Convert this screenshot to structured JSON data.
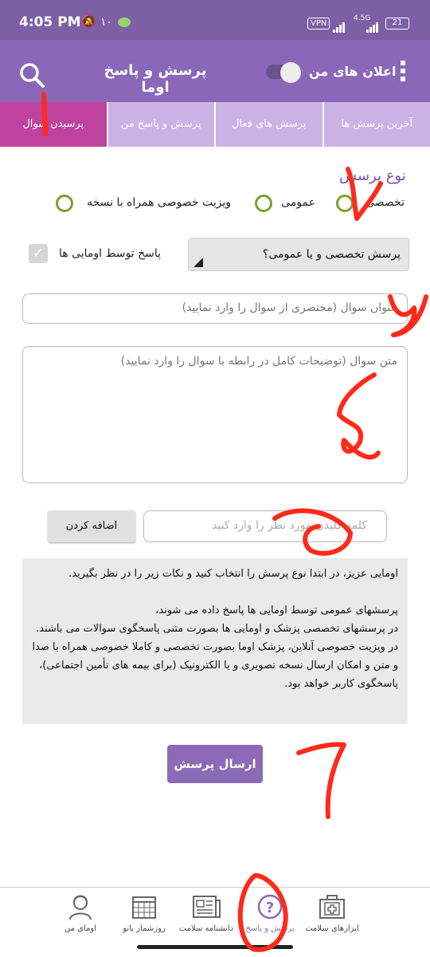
{
  "status_bar": {
    "time": "4:05 PM",
    "digit": "۱۰",
    "vpn": "VPN",
    "network": "4.5G",
    "battery": "21"
  },
  "header": {
    "title": "پرسش و پاسخ اوما",
    "notifications_label": "اعلان های من",
    "notifications_on": true
  },
  "tabs": [
    {
      "label": "آخرین پرسش ها",
      "active": false
    },
    {
      "label": "پرسش های فعال",
      "active": false
    },
    {
      "label": "پرسش و پاسخ من",
      "active": false
    },
    {
      "label": "پرسیدن سوال",
      "active": true
    }
  ],
  "form": {
    "type_label": "نوع پرسش",
    "radios": [
      {
        "label": "تخصصی"
      },
      {
        "label": "عمومی"
      },
      {
        "label": "ویزیت خصوصی همراه با نسخه"
      }
    ],
    "dropdown_text": "پرسش تخصصی و یا عمومی؟",
    "answer_by_umas_label": "پاسخ توسط اومایی ها",
    "answer_by_umas_checked": true,
    "title_placeholder": "عنوان سوال (مختصری از سوال را وارد نمایید)",
    "body_placeholder": "متن سوال (توضیحات کامل در رابطه با سوال را وارد نمایید)",
    "keyword_placeholder": "کلمه کلیدی مورد نظر را وارد کنید",
    "add_button": "اضافه کردن",
    "info_text": "اومایی عزیز، در ابتدا نوع پرسش را انتخاب کنید و نکات زیر را در نظر بگیرید.\n\nپرسشهای عمومی توسط اومایی ها پاسخ داده می شوند،\nدر پرسشهای تخصصی پزشک و اومایی ها بصورت متنی پاسخگوی سوالات می باشند.\nدر ویزیت خصوصی آنلاین، پزشک اوما بصورت تخصصی و کاملا خصوصی همراه با صدا و متن و امکان ارسال نسخه تصویری و یا الکترونیک (برای بیمه های تأمین اجتماعی)، پاسخگوی کاربر خواهد بود.",
    "submit_button": "ارسال پرسش"
  },
  "bottom_nav": [
    {
      "label": "اومای من",
      "icon": "user-icon"
    },
    {
      "label": "روزشمار بانو",
      "icon": "calendar-icon"
    },
    {
      "label": "دانشنامه سلامت",
      "icon": "newspaper-icon"
    },
    {
      "label": "پرسش و پاسخ",
      "icon": "question-icon",
      "active": true
    },
    {
      "label": "ابزارهای سلامت",
      "icon": "medical-kit-icon"
    }
  ],
  "annotations": [
    "۱",
    "۲",
    "۳",
    "۴",
    "۵",
    "۶"
  ],
  "colors": {
    "appbar": "#8a67b8",
    "statusbar": "#7d5fa6",
    "tab": "#ccb3e6",
    "tab_active": "#c0429f",
    "radio": "#7aa230",
    "accent": "#8b6ab8",
    "annotation": "#ff2a1a"
  }
}
